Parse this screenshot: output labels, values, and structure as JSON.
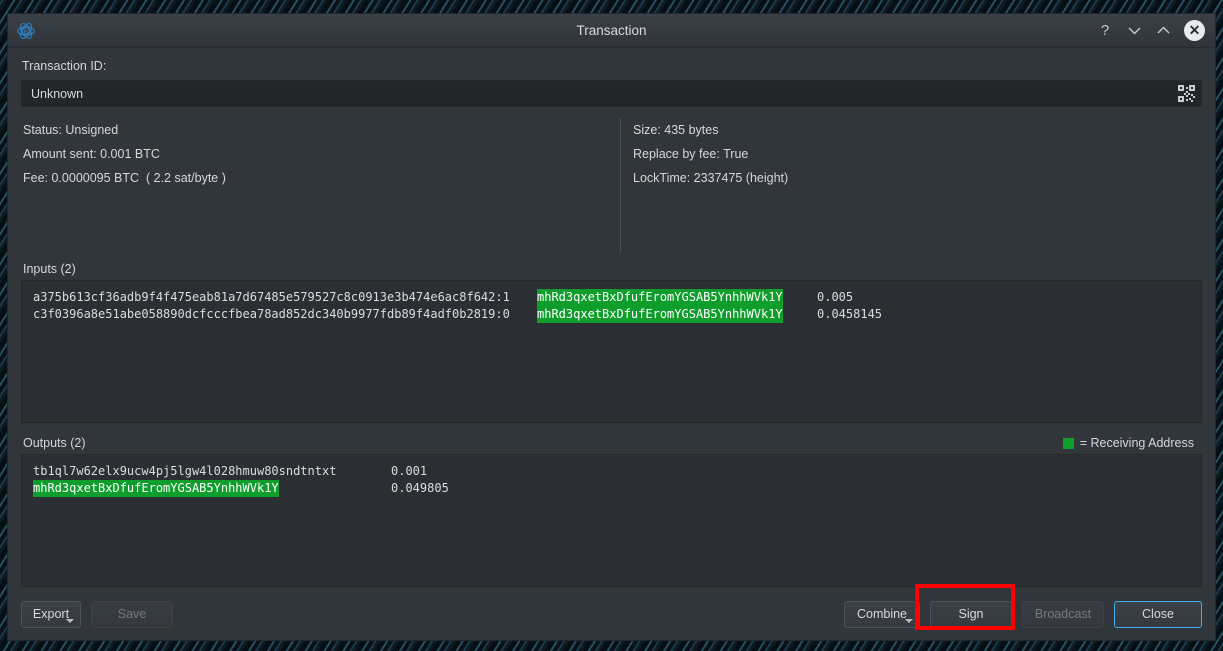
{
  "window": {
    "title": "Transaction",
    "logo_icon": "electrum-logo-icon",
    "controls": {
      "help_label": "?",
      "minimize_icon": "chevron-down-icon",
      "maximize_icon": "chevron-up-icon",
      "close_label": "✕"
    }
  },
  "transaction": {
    "id_label": "Transaction ID:",
    "id_value": "Unknown",
    "qr_icon": "qr-code-icon",
    "details_left": [
      "Status: Unsigned",
      "Amount sent: 0.001 BTC",
      "Fee: 0.0000095 BTC  ( 2.2 sat/byte )"
    ],
    "details_right": [
      "Size: 435 bytes",
      "Replace by fee: True",
      "LockTime: 2337475 (height)"
    ]
  },
  "inputs": {
    "header": "Inputs (2)",
    "rows": [
      {
        "txid": "a375b613cf36adb9f4f475eab81a7d67485e579527c8c0913e3b474e6ac8f642:1",
        "address": "mhRd3qxetBxDfufEromYGSAB5YnhhWVk1Y",
        "amount": "0.005",
        "receiving": true
      },
      {
        "txid": "c3f0396a8e51abe058890dcfcccfbea78ad852dc340b9977fdb89f4adf0b2819:0",
        "address": "mhRd3qxetBxDfufEromYGSAB5YnhhWVk1Y",
        "amount": "0.0458145",
        "receiving": true
      }
    ]
  },
  "outputs": {
    "header": "Outputs (2)",
    "legend_label": "= Receiving Address",
    "legend_color": "#0f9d2b",
    "rows": [
      {
        "address": "tb1ql7w62elx9ucw4pj5lgw4l028hmuw80sndtntxt",
        "amount": "0.001",
        "receiving": false
      },
      {
        "address": "mhRd3qxetBxDfufEromYGSAB5YnhhWVk1Y",
        "amount": "0.049805",
        "receiving": true
      }
    ]
  },
  "footer": {
    "export_label": "Export",
    "save_label": "Save",
    "combine_label": "Combine",
    "sign_label": "Sign",
    "broadcast_label": "Broadcast",
    "close_label": "Close"
  },
  "annotation": {
    "color": "#ff0000",
    "target": "sign-button"
  }
}
